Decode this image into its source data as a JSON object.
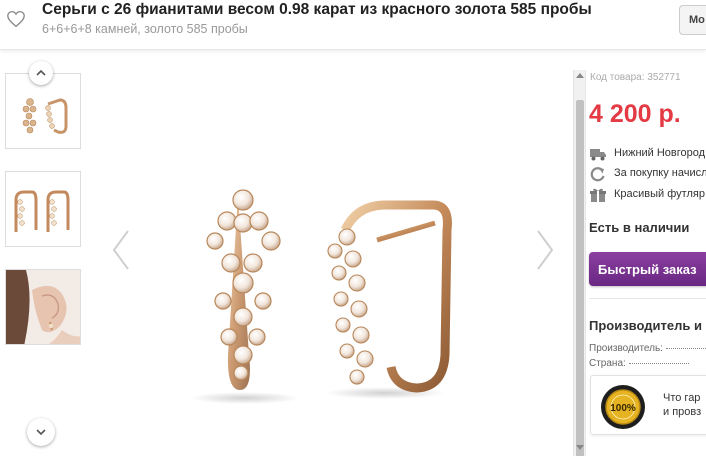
{
  "header": {
    "title": "Серьги с 26 фианитами весом 0.98 карат из красного золота 585 пробы",
    "subtitle": "6+6+6+8 камней, золото 585 пробы",
    "button_label": "Мо"
  },
  "product": {
    "code_label": "Код товара: 352771",
    "price": "4 200 р.",
    "delivery_text": "Нижний Новгород",
    "bonus_text": "За покупку начисл",
    "gift_text": "Красивый футляр",
    "stock_status": "Есть в наличии",
    "quick_order_label": "Быстрый заказ"
  },
  "manufacturer": {
    "title": "Производитель и",
    "fields": [
      {
        "label": "Производитель:"
      },
      {
        "label": "Страна:"
      }
    ]
  },
  "guarantee": {
    "badge_text": "100%",
    "line1": "Что гар",
    "line2": "и провз"
  },
  "colors": {
    "price": "#e33a44",
    "button": "#6a2783",
    "gold": "#d4a574"
  },
  "icons": [
    "heart-icon",
    "chevron-up-icon",
    "chevron-down-icon",
    "chevron-left-icon",
    "chevron-right-icon",
    "truck-icon",
    "refresh-icon",
    "gift-icon"
  ]
}
